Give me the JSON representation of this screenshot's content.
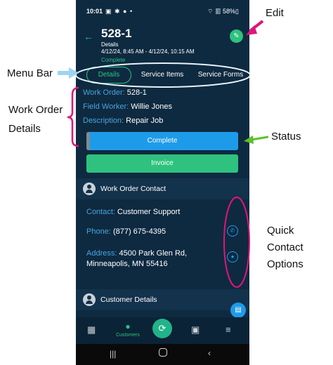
{
  "annotations": {
    "edit": "Edit",
    "menu_bar": "Menu Bar",
    "work_order_details": "Work Order Details",
    "status": "Status",
    "quick_contact": "Quick Contact Options"
  },
  "status_bar": {
    "time": "10:01",
    "icons": "▣ ✱ ● •",
    "right": "⌔ ▥ 58%▯"
  },
  "header": {
    "back_icon": "arrow-left-icon",
    "title": "528-1",
    "subtitle": "Details",
    "date_range": "4/12/24, 8:45 AM - 4/12/24, 10:15 AM",
    "status": "Complete",
    "edit_icon": "pencil-icon"
  },
  "tabs": [
    {
      "label": "Details",
      "active": true
    },
    {
      "label": "Service Items",
      "active": false
    },
    {
      "label": "Service Forms",
      "active": false
    }
  ],
  "work_order": {
    "number_label": "Work Order:",
    "number_value": "528-1",
    "worker_label": "Field Worker:",
    "worker_value": "Willie Jones",
    "description_label": "Description:",
    "description_value": "Repair Job"
  },
  "buttons": {
    "complete": "Complete",
    "invoice": "Invoice"
  },
  "sections": {
    "work_order_contact": "Work Order Contact",
    "customer_details": "Customer Details"
  },
  "contact": {
    "contact_label": "Contact:",
    "contact_value": "Customer Support",
    "phone_label": "Phone:",
    "phone_value": "(877) 675-4395",
    "address_label": "Address:",
    "address_value": "4500 Park Glen Rd, Minneapolis, MN 55416"
  },
  "nav": {
    "customers_label": "Customers"
  },
  "colors": {
    "background": "#0e2a40",
    "accent_green": "#2ec27e",
    "accent_blue": "#1e9be8",
    "annotation_pink": "#e0157a",
    "annotation_light_blue": "#9fd3f0",
    "annotation_green": "#5cc02f"
  }
}
